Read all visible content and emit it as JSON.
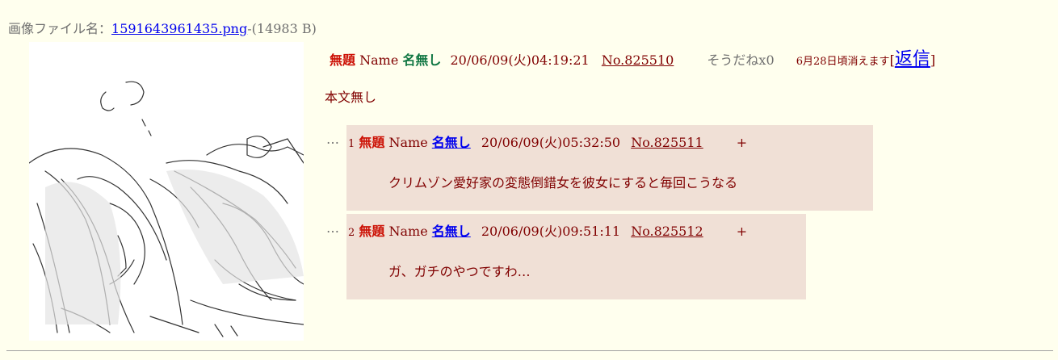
{
  "file": {
    "label": "画像ファイル名：",
    "name": "1591643961435.png",
    "size": "-(14983 B)"
  },
  "op": {
    "subject": "無題",
    "name_label": "Name",
    "name": "名無し",
    "datetime": "20/06/09(火)04:19:21",
    "no": "No.825510",
    "sodane": "そうだねx0",
    "expire": "6月28日頃消えます",
    "reply_open": "[",
    "reply_link": "返信",
    "reply_close": "]",
    "body": "本文無し"
  },
  "replies": [
    {
      "dots": "…",
      "index": "1",
      "subject": "無題",
      "name_label": "Name",
      "name": "名無し",
      "datetime": "20/06/09(火)05:32:50",
      "no": "No.825511",
      "plus": "+",
      "body": "クリムゾン愛好家の変態倒錯女を彼女にすると毎回こうなる"
    },
    {
      "dots": "…",
      "index": "2",
      "subject": "無題",
      "name_label": "Name",
      "name": "名無し",
      "datetime": "20/06/09(火)09:51:11",
      "no": "No.825512",
      "plus": "+",
      "body": "ガ、ガチのやつですわ…"
    }
  ]
}
